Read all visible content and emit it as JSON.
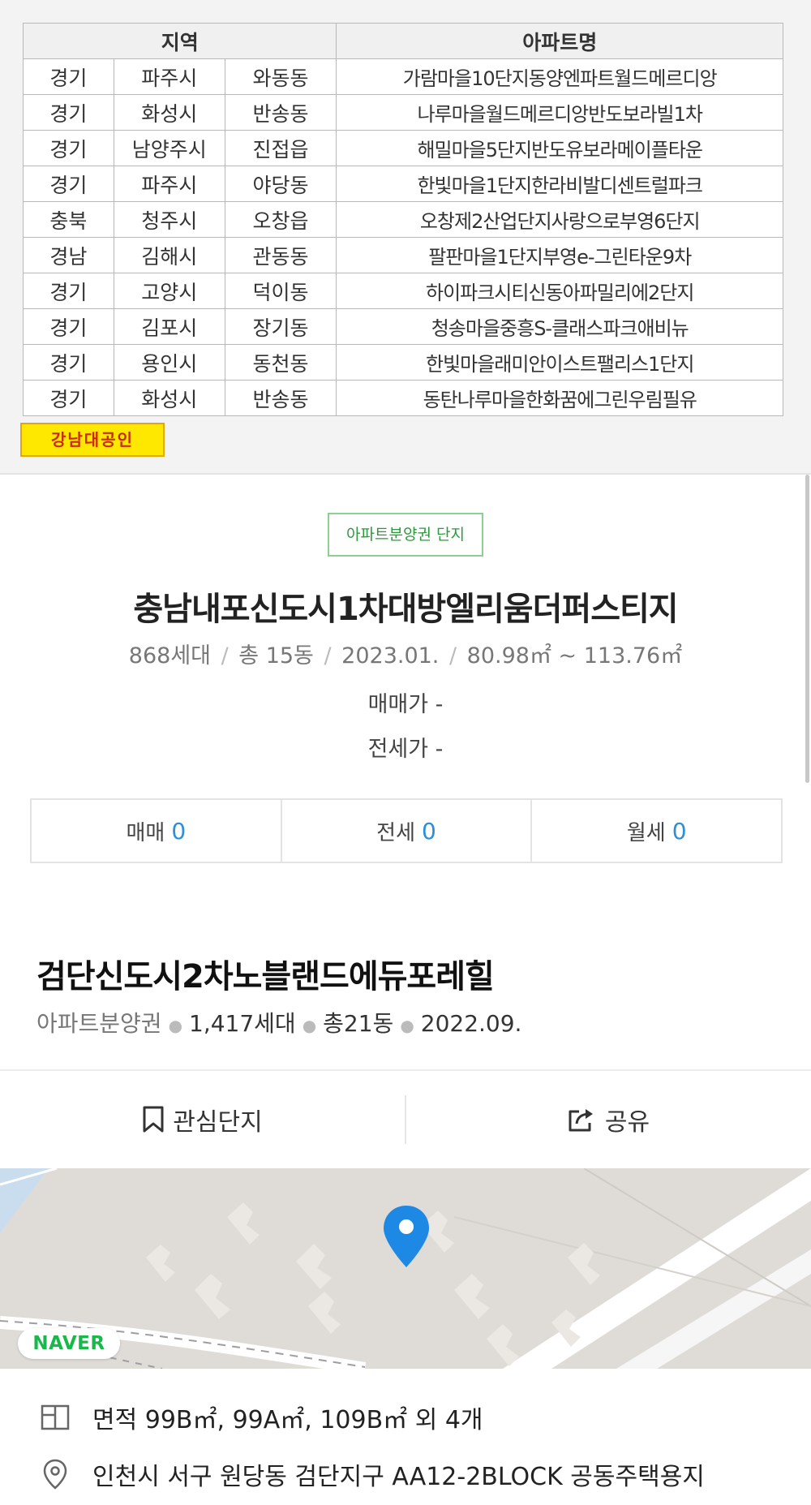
{
  "table": {
    "headers": {
      "region": "지역",
      "apt": "아파트명"
    },
    "rows": [
      [
        "경기",
        "파주시",
        "와동동",
        "가람마을10단지동양엔파트월드메르디앙"
      ],
      [
        "경기",
        "화성시",
        "반송동",
        "나루마을월드메르디앙반도보라빌1차"
      ],
      [
        "경기",
        "남양주시",
        "진접읍",
        "해밀마을5단지반도유보라메이플타운"
      ],
      [
        "경기",
        "파주시",
        "야당동",
        "한빛마을1단지한라비발디센트럴파크"
      ],
      [
        "충북",
        "청주시",
        "오창읍",
        "오창제2산업단지사랑으로부영6단지"
      ],
      [
        "경남",
        "김해시",
        "관동동",
        "팔판마을1단지부영e-그린타운9차"
      ],
      [
        "경기",
        "고양시",
        "덕이동",
        "하이파크시티신동아파밀리에2단지"
      ],
      [
        "경기",
        "김포시",
        "장기동",
        "청송마을중흥S-클래스파크애비뉴"
      ],
      [
        "경기",
        "용인시",
        "동천동",
        "한빛마을래미안이스트팰리스1단지"
      ],
      [
        "경기",
        "화성시",
        "반송동",
        "동탄나루마을한화꿈에그린우림필유"
      ]
    ],
    "broker_badge": "강남대공인"
  },
  "complex1": {
    "tag": "아파트분양권 단지",
    "title": "충남내포신도시1차대방엘리움더퍼스티지",
    "households": "868세대",
    "buildings": "총 15동",
    "date": "2023.01.",
    "area_range": "80.98㎡ ~ 113.76㎡",
    "sale_price": "매매가 -",
    "jeonse_price": "전세가 -",
    "tabs": [
      {
        "label": "매매",
        "count": "0"
      },
      {
        "label": "전세",
        "count": "0"
      },
      {
        "label": "월세",
        "count": "0"
      }
    ]
  },
  "complex2": {
    "title": "검단신도시2차노블랜드에듀포레힐",
    "type": "아파트분양권",
    "households": "1,417세대",
    "buildings": "총21동",
    "date": "2022.09.",
    "favorite_label": "관심단지",
    "share_label": "공유",
    "map_brand": "NAVER",
    "area": "면적 99B㎡, 99A㎡, 109B㎡ 외 4개",
    "address": "인천시 서구 원당동 검단지구 AA12-2BLOCK 공동주택용지"
  },
  "colors": {
    "accent_blue": "#2f8ed8",
    "tag_green": "#2a9a3a",
    "naver_green": "#19b84b",
    "pin_blue": "#1e88e5",
    "badge_yellow": "#ffe800"
  }
}
